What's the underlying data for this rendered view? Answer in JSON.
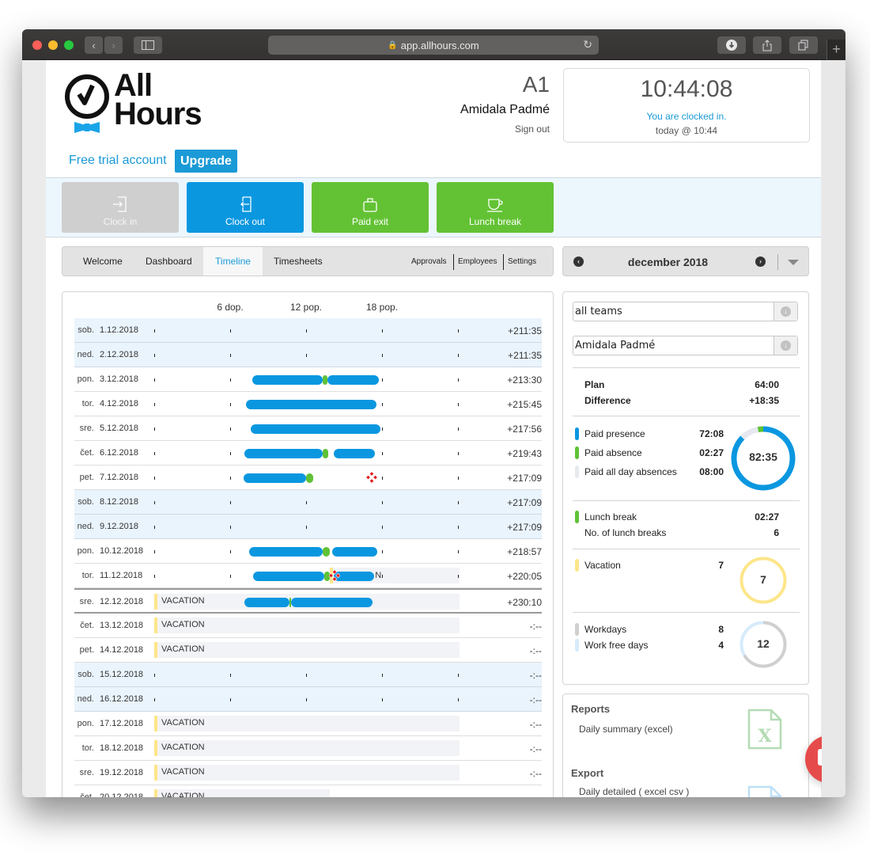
{
  "browser": {
    "url": "app.allhours.com",
    "back_icon": "chevron-left-icon",
    "forward_icon": "chevron-right-icon",
    "sidebar_icon": "sidebar-icon",
    "reload_icon": "reload-icon",
    "download_icon": "download-icon",
    "share_icon": "share-icon",
    "tabs_icon": "tabs-icon",
    "new_tab_icon": "plus-icon"
  },
  "header": {
    "logo_line1": "All",
    "logo_line2": "Hours",
    "trial_text": "Free trial account",
    "upgrade_label": "Upgrade",
    "user_code": "A1",
    "user_name": "Amidala Padmé",
    "signout_label": "Sign out"
  },
  "clock": {
    "time": "10:44:08",
    "status": "You are clocked in.",
    "since": "today @ 10:44"
  },
  "actions": [
    {
      "label": "Clock in",
      "icon": "clock-in-icon",
      "color": "#cfcfcf",
      "disabled": true
    },
    {
      "label": "Clock out",
      "icon": "clock-out-icon",
      "color": "#0a97e0",
      "disabled": false
    },
    {
      "label": "Paid exit",
      "icon": "briefcase-icon",
      "color": "#63c234",
      "disabled": false
    },
    {
      "label": "Lunch break",
      "icon": "coffee-cup-icon",
      "color": "#63c234",
      "disabled": false
    }
  ],
  "nav": {
    "tabs": [
      "Welcome",
      "Dashboard",
      "Timeline",
      "Timesheets"
    ],
    "active_tab": "Timeline",
    "subtabs": [
      "Approvals",
      "Employees",
      "Settings"
    ]
  },
  "month_nav": {
    "label": "december 2018"
  },
  "timeline": {
    "hour_labels": [
      {
        "hour": 6,
        "label": "6 dop."
      },
      {
        "hour": 12,
        "label": "12 pop."
      },
      {
        "hour": 18,
        "label": "18 pop."
      }
    ],
    "vacation_label": "VACATION",
    "colors": {
      "work": "#0a97e0",
      "lunch": "#5fc235",
      "vacation": "#fde68a",
      "marker": "#e02020"
    },
    "rows": [
      {
        "day": "sob.",
        "date": "1.12.2018",
        "type": "weekend",
        "balance": "+211:35",
        "segments": []
      },
      {
        "day": "ned.",
        "date": "2.12.2018",
        "type": "weekend",
        "balance": "+211:35",
        "segments": []
      },
      {
        "day": "pon.",
        "date": "3.12.2018",
        "type": "work",
        "balance": "+213:30",
        "segments": [
          {
            "kind": "work",
            "start": 7.75,
            "end": 13.3
          },
          {
            "kind": "lunch",
            "start": 13.3,
            "end": 13.7
          },
          {
            "kind": "work",
            "start": 13.7,
            "end": 17.75
          }
        ]
      },
      {
        "day": "tor.",
        "date": "4.12.2018",
        "type": "work",
        "balance": "+215:45",
        "segments": [
          {
            "kind": "work",
            "start": 7.25,
            "end": 17.55
          }
        ]
      },
      {
        "day": "sre.",
        "date": "5.12.2018",
        "type": "work",
        "balance": "+217:56",
        "segments": [
          {
            "kind": "work",
            "start": 7.6,
            "end": 17.9
          }
        ]
      },
      {
        "day": "čet.",
        "date": "6.12.2018",
        "type": "work",
        "balance": "+219:43",
        "segments": [
          {
            "kind": "work",
            "start": 7.1,
            "end": 13.3
          },
          {
            "kind": "lunch",
            "start": 13.3,
            "end": 13.75
          },
          {
            "kind": "work",
            "start": 14.2,
            "end": 17.45
          }
        ]
      },
      {
        "day": "pet.",
        "date": "7.12.2018",
        "type": "work",
        "balance": "+217:09",
        "segments": [
          {
            "kind": "work",
            "start": 7.05,
            "end": 12.0
          },
          {
            "kind": "lunch",
            "start": 12.0,
            "end": 12.55
          }
        ],
        "markers": [
          17.2
        ]
      },
      {
        "day": "sob.",
        "date": "8.12.2018",
        "type": "weekend",
        "balance": "+217:09",
        "segments": []
      },
      {
        "day": "ned.",
        "date": "9.12.2018",
        "type": "weekend",
        "balance": "+217:09",
        "segments": []
      },
      {
        "day": "pon.",
        "date": "10.12.2018",
        "type": "work",
        "balance": "+218:57",
        "segments": [
          {
            "kind": "work",
            "start": 7.5,
            "end": 13.3
          },
          {
            "kind": "lunch",
            "start": 13.3,
            "end": 13.85
          },
          {
            "kind": "work",
            "start": 14.05,
            "end": 17.6
          }
        ]
      },
      {
        "day": "tor.",
        "date": "11.12.2018",
        "type": "work-partial",
        "balance": "+220:05",
        "segments": [
          {
            "kind": "work",
            "start": 7.8,
            "end": 13.45
          },
          {
            "kind": "lunch",
            "start": 13.45,
            "end": 13.9
          },
          {
            "kind": "vac",
            "start": 13.9,
            "end": 14.15
          },
          {
            "kind": "work",
            "start": 14.2,
            "end": 17.4
          }
        ],
        "markers": [
          14.25
        ],
        "note": "N"
      },
      {
        "day": "sre.",
        "date": "12.12.2018",
        "type": "vacation-today",
        "balance": "+230:10",
        "segments": [
          {
            "kind": "work",
            "start": 7.1,
            "end": 10.7
          },
          {
            "kind": "lunch",
            "start": 10.7,
            "end": 10.8
          },
          {
            "kind": "work",
            "start": 10.8,
            "end": 17.25
          }
        ]
      },
      {
        "day": "čet.",
        "date": "13.12.2018",
        "type": "vacation",
        "balance": "-:--",
        "segments": []
      },
      {
        "day": "pet.",
        "date": "14.12.2018",
        "type": "vacation",
        "balance": "-:--",
        "segments": []
      },
      {
        "day": "sob.",
        "date": "15.12.2018",
        "type": "weekend",
        "balance": "-:--",
        "segments": []
      },
      {
        "day": "ned.",
        "date": "16.12.2018",
        "type": "weekend",
        "balance": "-:--",
        "segments": []
      },
      {
        "day": "pon.",
        "date": "17.12.2018",
        "type": "vacation",
        "balance": "-:--",
        "segments": []
      },
      {
        "day": "tor.",
        "date": "18.12.2018",
        "type": "vacation",
        "balance": "-:--",
        "segments": []
      },
      {
        "day": "sre.",
        "date": "19.12.2018",
        "type": "vacation",
        "balance": "-:--",
        "segments": []
      },
      {
        "day": "čet.",
        "date": "20.12.2018",
        "type": "vacation-cut",
        "balance": "",
        "segments": []
      }
    ]
  },
  "filters": {
    "team": "all teams",
    "employee": "Amidala Padmé"
  },
  "stats": {
    "plan_label": "Plan",
    "plan_value": "64:00",
    "diff_label": "Difference",
    "diff_value": "+18:35",
    "presence": [
      {
        "label": "Paid presence",
        "value": "72:08",
        "color": "#0a97e0",
        "hours": 72.13
      },
      {
        "label": "Paid absence",
        "value": "02:27",
        "color": "#5fc235",
        "hours": 2.45
      },
      {
        "label": "Paid all day absences",
        "value": "08:00",
        "color": "#e6e9ef",
        "hours": 8.0
      }
    ],
    "presence_total": "82:35",
    "lunch_label": "Lunch break",
    "lunch_value": "02:27",
    "lunch_color": "#5fc235",
    "lunch_count_label": "No. of lunch breaks",
    "lunch_count_value": "6",
    "vacation_label": "Vacation",
    "vacation_value": "7",
    "vacation_color": "#fde68a",
    "vacation_total": "7",
    "days": [
      {
        "label": "Workdays",
        "value": "8",
        "color": "#cfcfcf",
        "count": 8
      },
      {
        "label": "Work free days",
        "value": "4",
        "color": "#d6ebfb",
        "count": 4
      }
    ],
    "days_total": "12"
  },
  "reports": {
    "reports_title": "Reports",
    "reports_link": "Daily summary (excel)",
    "export_title": "Export",
    "export_link": "Daily detailed ( excel csv )"
  },
  "chat": {
    "icon": "chat-icon"
  }
}
